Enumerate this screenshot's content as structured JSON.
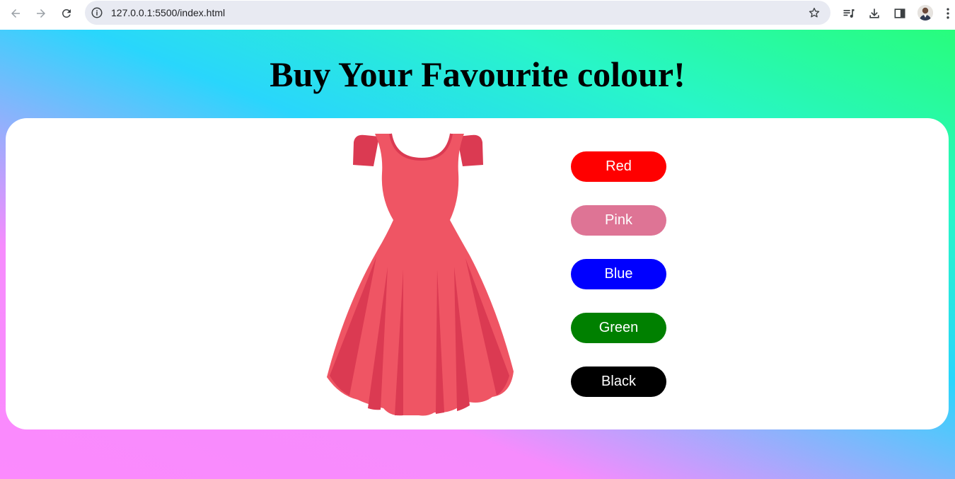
{
  "browser": {
    "url": "127.0.0.1:5500/index.html",
    "icons": {
      "back": "back-arrow-icon",
      "forward": "forward-arrow-icon",
      "reload": "reload-icon",
      "info": "info-icon",
      "bookmark": "star-icon",
      "media": "media-queue-icon",
      "download": "download-icon",
      "sidepanel": "side-panel-icon",
      "menu": "kebab-menu-icon"
    }
  },
  "page": {
    "title": "Buy Your Favourite colour!",
    "dress_icon": "dress-icon",
    "dress_color": "#ef5564",
    "color_buttons": [
      {
        "label": "Red",
        "color": "#ff0000"
      },
      {
        "label": "Pink",
        "color": "#de7495"
      },
      {
        "label": "Blue",
        "color": "#0000ff"
      },
      {
        "label": "Green",
        "color": "#008000"
      },
      {
        "label": "Black",
        "color": "#000000"
      }
    ]
  }
}
